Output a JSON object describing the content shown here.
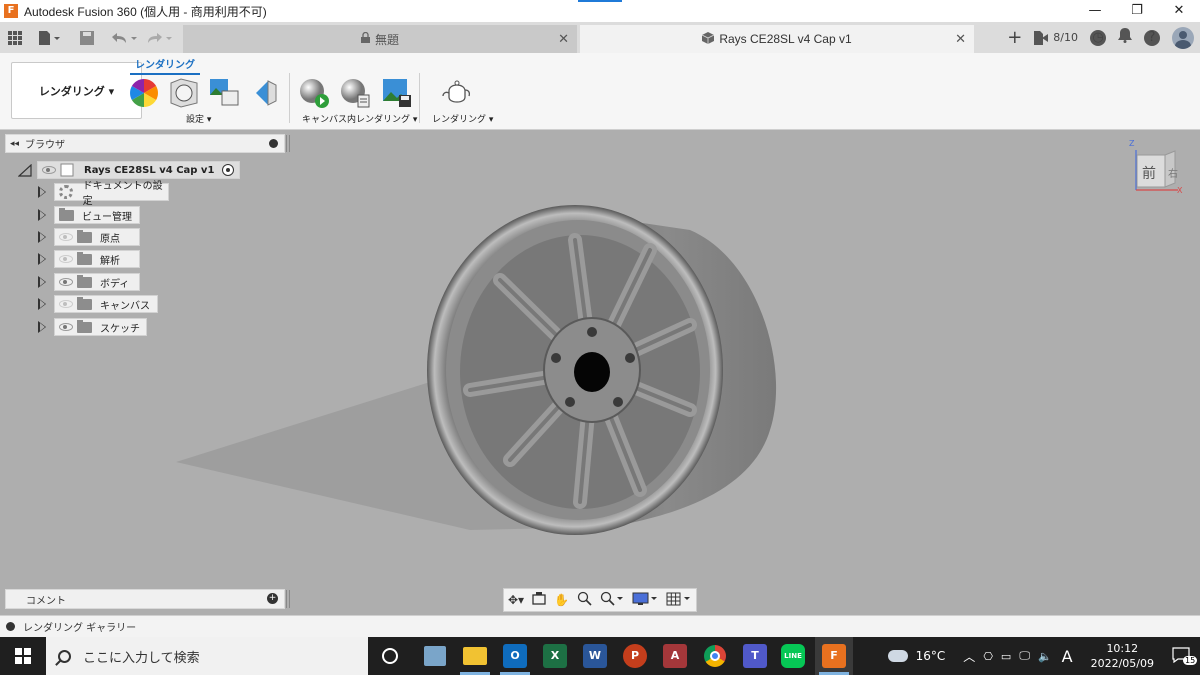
{
  "window": {
    "title": "Autodesk Fusion 360 (個人用 - 商用利用不可)",
    "minimize": "—",
    "maximize": "❐",
    "close": "✕"
  },
  "tabs": {
    "inactive_label": "無題",
    "active_label": "Rays CE28SL v4 Cap v1",
    "close_glyph": "✕",
    "new_tab": "+",
    "job_count": "8/10"
  },
  "ribbon": {
    "workspace": "レンダリング ▾",
    "tab_label": "レンダリング",
    "groups": [
      {
        "label": "設定 ▾"
      },
      {
        "label": "キャンバス内レンダリング ▾"
      },
      {
        "label": "レンダリング ▾"
      }
    ]
  },
  "browser": {
    "title": "ブラウザ",
    "collapse": "◂◂",
    "root": "Rays CE28SL v4 Cap v1",
    "items": [
      {
        "label": "ドキュメントの設定",
        "icon": "gear-icon",
        "eye": "none"
      },
      {
        "label": "ビュー管理",
        "icon": "folder-icon",
        "eye": "none"
      },
      {
        "label": "原点",
        "icon": "folder-icon",
        "eye": "dim"
      },
      {
        "label": "解析",
        "icon": "folder-icon",
        "eye": "dim"
      },
      {
        "label": "ボディ",
        "icon": "folder-icon",
        "eye": "on"
      },
      {
        "label": "キャンバス",
        "icon": "folder-icon",
        "eye": "dim"
      },
      {
        "label": "スケッチ",
        "icon": "folder-icon",
        "eye": "on"
      }
    ]
  },
  "comments": {
    "title": "コメント",
    "add": "+"
  },
  "viewcube": {
    "face_front": "前",
    "face_right": "右",
    "axis_z": "Z",
    "axis_x": "X"
  },
  "gallery": {
    "label": "レンダリング ギャラリー"
  },
  "taskbar": {
    "search_placeholder": "ここに入力して検索",
    "weather": "16°C",
    "ime": "A",
    "time": "10:12",
    "date": "2022/05/09",
    "notifications": "15",
    "apps": [
      {
        "name": "Outlook",
        "short": "O",
        "color": "#0f6cbd"
      },
      {
        "name": "Excel",
        "short": "X",
        "color": "#1d7044"
      },
      {
        "name": "Word",
        "short": "W",
        "color": "#2a5699"
      },
      {
        "name": "PowerPoint",
        "short": "P",
        "color": "#c43e1c"
      },
      {
        "name": "Access",
        "short": "A",
        "color": "#a4373a"
      },
      {
        "name": "Teams",
        "short": "T",
        "color": "#5059c9"
      },
      {
        "name": "LINE",
        "short": "LINE",
        "color": "#06c755"
      },
      {
        "name": "Fusion 360",
        "short": "F",
        "color": "#e8711f"
      }
    ]
  }
}
